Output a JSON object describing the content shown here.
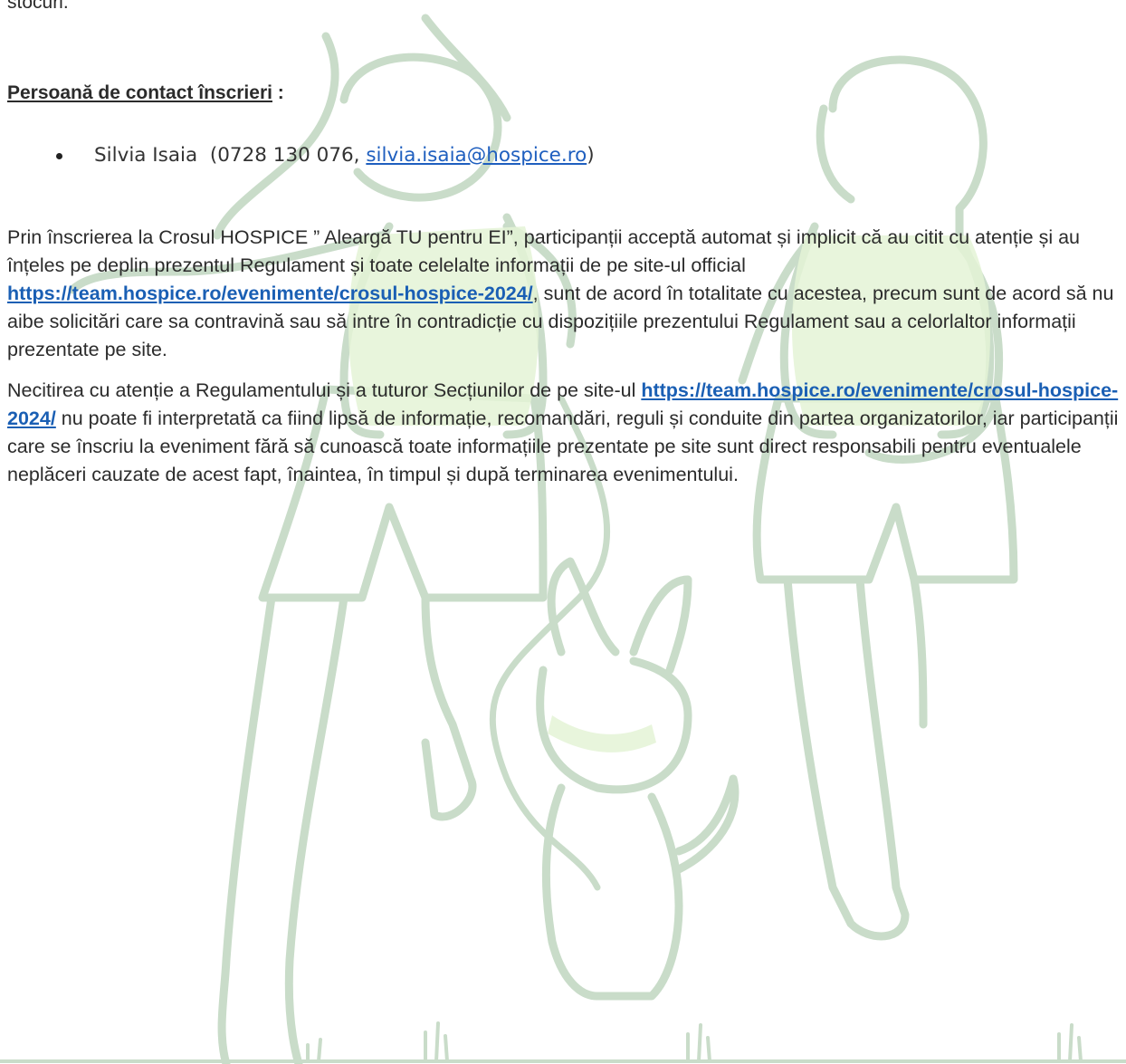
{
  "fragment_top": "stocuri.",
  "contact": {
    "heading": "Persoană de contact înscrieri",
    "heading_suffix": " :",
    "person": {
      "name": "Silvia Isaia",
      "phone_prefix": "  (0728 130 076, ",
      "email": "silvia.isaia@hospice.ro",
      "suffix": ")"
    }
  },
  "paragraph1": {
    "part1": "Prin înscrierea la Crosul HOSPICE ” Aleargă TU pentru EI”, participanții acceptă automat și implicit că au citit cu atenție și au înțeles pe deplin prezentul Regulament și toate celelalte informații de pe site-ul official ",
    "link": "https://team.hospice.ro/evenimente/crosul-hospice-2024/",
    "part2": ", sunt de acord în totalitate cu acestea, precum sunt de acord să nu aibe solicitări care sa contravină sau să intre în contradicție cu dispozițiile prezentului Regulament sau a celorlaltor informații prezentate pe site."
  },
  "paragraph2": {
    "part1": "Necitirea cu atenție a Regulamentului și a tuturor Secțiunilor de pe site-ul ",
    "link": "https://team.hospice.ro/evenimente/crosul-hospice-2024/",
    "part2": " nu poate fi interpretată ca fiind lipsă de informație, recomandări, reguli și conduite din partea organizatorilor, iar participanții care se înscriu la eveniment fără să cunoască toate informațiile prezentate pe site sunt direct responsabili pentru eventualele neplăceri cauzate de acest fapt, înaintea, în timpul și după terminarea evenimentului."
  },
  "colors": {
    "watermark_outline": "#c9dcc9",
    "watermark_fill": "#e4f3d6",
    "link": "#1a5fb4"
  },
  "icons": {
    "bullet": "bullet-dot-icon",
    "watermark": "runners-with-dog-watermark"
  }
}
